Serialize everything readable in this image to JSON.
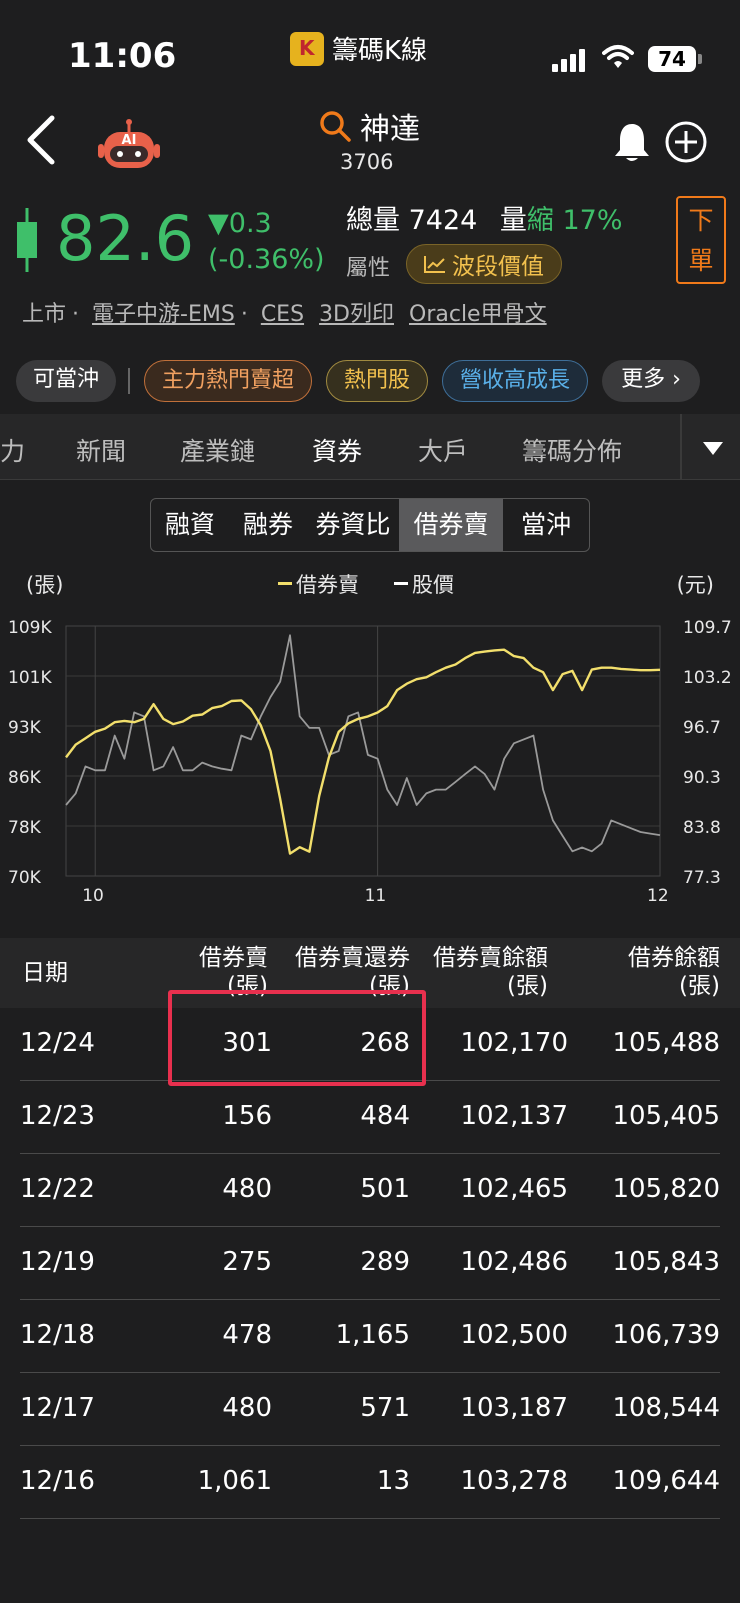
{
  "status_bar": {
    "time": "11:06",
    "app_name": "籌碼K線",
    "app_logo_letter": "K",
    "battery": "74"
  },
  "header": {
    "stock_name": "神達",
    "stock_code": "3706",
    "ai_label": "AI"
  },
  "quote": {
    "price": "82.6",
    "change": "▼0.3",
    "change_pct": "(-0.36%)",
    "volume_label": "總量",
    "volume_value": "7424",
    "volume_shrink_prefix": "量",
    "volume_shrink_word": "縮",
    "volume_shrink_pct": "17%",
    "attr_label": "屬性",
    "wave_badge": "波段價值",
    "order_button_line1": "下",
    "order_button_line2": "單",
    "price_color": "#3fbf6a"
  },
  "tags": {
    "market": "上市",
    "links": [
      "電子中游-EMS",
      "CES",
      "3D列印",
      "Oracle甲骨文"
    ]
  },
  "chips": [
    "可當沖",
    "主力熱門賣超",
    "熱門股",
    "營收高成長",
    "更多 ›"
  ],
  "tabs": [
    "力",
    "新聞",
    "產業鏈",
    "資券",
    "大戶",
    "籌碼分佈"
  ],
  "active_tab": "資券",
  "subtabs": [
    "融資",
    "融券",
    "券資比",
    "借券賣",
    "當沖"
  ],
  "active_subtab": "借券賣",
  "chart_data": {
    "type": "line",
    "left_unit": "(張)",
    "right_unit": "(元)",
    "legend": [
      "借券賣",
      "股價"
    ],
    "y_left_ticks": [
      "109K",
      "101K",
      "93K",
      "86K",
      "78K",
      "70K"
    ],
    "y_left_range": [
      70000,
      109000
    ],
    "y_right_ticks": [
      "109.7",
      "103.2",
      "96.7",
      "90.3",
      "83.8",
      "77.3"
    ],
    "y_right_range": [
      77.3,
      109.7
    ],
    "x_ticks": [
      "10",
      "11",
      "12"
    ],
    "x_tick_index": [
      3,
      32,
      61
    ],
    "grid": true,
    "series": [
      {
        "name": "借券賣",
        "color": "#f2df6c",
        "values": [
          88500,
          90500,
          91500,
          92500,
          93000,
          94000,
          94200,
          94000,
          94500,
          96800,
          94500,
          93700,
          94100,
          95000,
          95200,
          96200,
          96500,
          97300,
          97400,
          96000,
          93500,
          89500,
          82000,
          73500,
          74500,
          73800,
          82500,
          88500,
          92500,
          93800,
          94500,
          94900,
          95500,
          96500,
          99000,
          100000,
          100700,
          101000,
          101800,
          102500,
          103000,
          104000,
          104800,
          105000,
          105200,
          105300,
          104300,
          104000,
          102500,
          101800,
          99000,
          101500,
          102000,
          99000,
          102200,
          102500,
          102500,
          102300,
          102200,
          102100,
          102100,
          102170
        ]
      },
      {
        "name": "股價",
        "color": "#9a9a9a",
        "values": [
          86.5,
          88.0,
          91.5,
          91.0,
          91.0,
          95.5,
          92.5,
          98.5,
          98.0,
          91.0,
          91.5,
          94.0,
          91.0,
          91.0,
          92.0,
          91.5,
          91.2,
          91.0,
          95.5,
          95.0,
          98.0,
          100.5,
          102.5,
          108.5,
          98.0,
          96.5,
          96.5,
          93.0,
          93.5,
          98.0,
          98.5,
          93.0,
          92.5,
          88.5,
          86.5,
          90.0,
          86.5,
          88.0,
          88.5,
          88.5,
          89.5,
          90.5,
          91.5,
          90.5,
          88.5,
          92.5,
          94.5,
          95.0,
          95.5,
          88.5,
          84.5,
          82.5,
          80.5,
          81.0,
          80.5,
          81.5,
          84.5,
          84.0,
          83.5,
          83.0,
          82.8,
          82.6
        ]
      }
    ]
  },
  "table": {
    "headers": [
      {
        "line1": "日期",
        "line2": ""
      },
      {
        "line1": "借券賣",
        "line2": "(張)"
      },
      {
        "line1": "借券賣還券",
        "line2": "(張)"
      },
      {
        "line1": "借券賣餘額",
        "line2": "(張)"
      },
      {
        "line1": "借券餘額",
        "line2": "(張)"
      }
    ],
    "rows": [
      {
        "date": "12/24",
        "sell": "301",
        "return": "268",
        "sell_bal": "102,170",
        "lend_bal": "105,488"
      },
      {
        "date": "12/23",
        "sell": "156",
        "return": "484",
        "sell_bal": "102,137",
        "lend_bal": "105,405"
      },
      {
        "date": "12/22",
        "sell": "480",
        "return": "501",
        "sell_bal": "102,465",
        "lend_bal": "105,820"
      },
      {
        "date": "12/19",
        "sell": "275",
        "return": "289",
        "sell_bal": "102,486",
        "lend_bal": "105,843"
      },
      {
        "date": "12/18",
        "sell": "478",
        "return": "1,165",
        "sell_bal": "102,500",
        "lend_bal": "106,739"
      },
      {
        "date": "12/17",
        "sell": "480",
        "return": "571",
        "sell_bal": "103,187",
        "lend_bal": "108,544"
      },
      {
        "date": "12/16",
        "sell": "1,061",
        "return": "13",
        "sell_bal": "103,278",
        "lend_bal": "109,644"
      }
    ],
    "highlight_color": "#e8304e"
  }
}
